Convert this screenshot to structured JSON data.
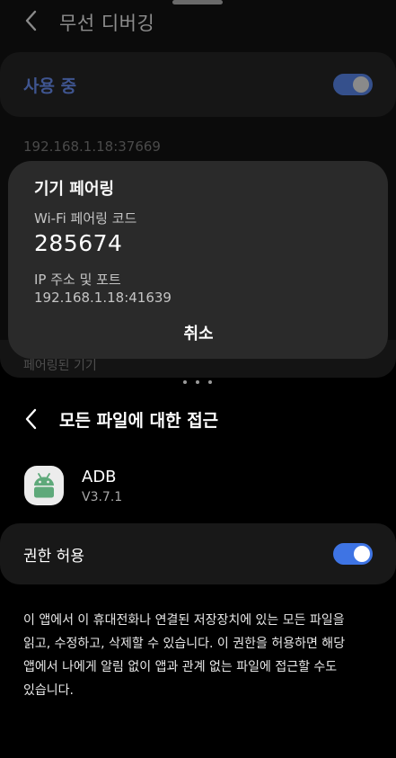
{
  "top_window": {
    "title": "무선 디버깅",
    "using_label": "사용 중",
    "using_enabled": true,
    "ip_address_faded": "192.168.1.18:37669",
    "paired_devices_label": "페어링된 기기"
  },
  "dialog": {
    "title": "기기 페어링",
    "code_label": "Wi-Fi 페어링 코드",
    "code": "285674",
    "ip_label": "IP 주소 및 포트",
    "ip_value": "192.168.1.18:41639",
    "cancel_label": "취소"
  },
  "bottom_window": {
    "title": "모든 파일에 대한 접근",
    "app": {
      "name": "ADB",
      "version": "V3.7.1",
      "icon": "android-icon"
    },
    "permission_label": "권한 허용",
    "permission_enabled": true,
    "description": "이 앱에서 이 휴대전화나 연결된 저장장치에 있는 모든 파일을 읽고, 수정하고, 삭제할 수 있습니다. 이 권한을 허용하면 해당 앱에서 나에게 알림 없이 앱과 관계 없는 파일에 접근할 수도 있습니다."
  },
  "colors": {
    "accent": "#3e74e4",
    "android_green": "#5ea97a"
  }
}
